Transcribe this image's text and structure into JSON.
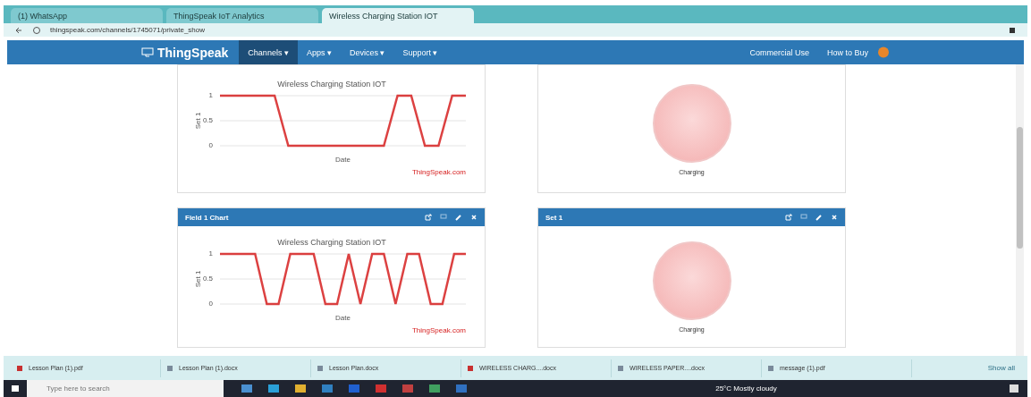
{
  "browser": {
    "tabs": [
      {
        "label": "(1) WhatsApp",
        "selected": false
      },
      {
        "label": "ThingSpeak IoT Analytics",
        "selected": false
      },
      {
        "label": "Wireless Charging Station IOT",
        "selected": true
      }
    ],
    "url": "thingspeak.com/channels/1745071/private_show"
  },
  "nav": {
    "brand": "ThingSpeak",
    "menu": [
      {
        "label": "Channels ▾",
        "selected": true
      },
      {
        "label": "Apps ▾",
        "selected": false
      },
      {
        "label": "Devices ▾",
        "selected": false
      },
      {
        "label": "Support ▾",
        "selected": false
      }
    ],
    "right": [
      "Commercial Use",
      "How to Buy"
    ]
  },
  "panels": [
    {
      "kind": "chart",
      "chart_data": {
        "type": "line",
        "title": "Wireless Charging Station IOT",
        "xlabel": "Date",
        "ylabel": "Set 1",
        "yticks": [
          0,
          0.5,
          1
        ],
        "ylim": [
          0,
          1
        ],
        "series": [
          {
            "name": "ThingSpeak.com",
            "color": "#d62020",
            "values": [
              1,
              1,
              1,
              1,
              1,
              0,
              0,
              0,
              0,
              0,
              0,
              0,
              0,
              1,
              1,
              0,
              0,
              1,
              1
            ]
          }
        ]
      }
    },
    {
      "kind": "lamp",
      "label": "Charging",
      "on": false
    },
    {
      "kind": "chart",
      "title": "Field 1 Chart",
      "chart_data": {
        "type": "line",
        "title": "Wireless Charging Station IOT",
        "xlabel": "Date",
        "ylabel": "Set 1",
        "yticks": [
          0,
          0.5,
          1
        ],
        "ylim": [
          0,
          1
        ],
        "series": [
          {
            "name": "ThingSpeak.com",
            "color": "#d62020",
            "values": [
              1,
              1,
              1,
              1,
              0,
              0,
              1,
              1,
              1,
              0,
              0,
              1,
              0,
              1,
              1,
              0,
              1,
              1,
              0,
              0,
              1,
              1
            ]
          }
        ]
      }
    },
    {
      "kind": "lamp",
      "title": "Set 1",
      "label": "Charging",
      "on": false
    }
  ],
  "downloads": {
    "items": [
      "Lesson Plan (1).pdf",
      "Lesson Plan (1).docx",
      "Lesson Plan.docx",
      "WIRELESS CHARG....docx",
      "WIRELESS PAPER....docx",
      "message (1).pdf"
    ],
    "show_all": "Show all"
  },
  "taskbar": {
    "search_placeholder": "Type here to search",
    "weather": "25°C  Mostly cloudy"
  }
}
